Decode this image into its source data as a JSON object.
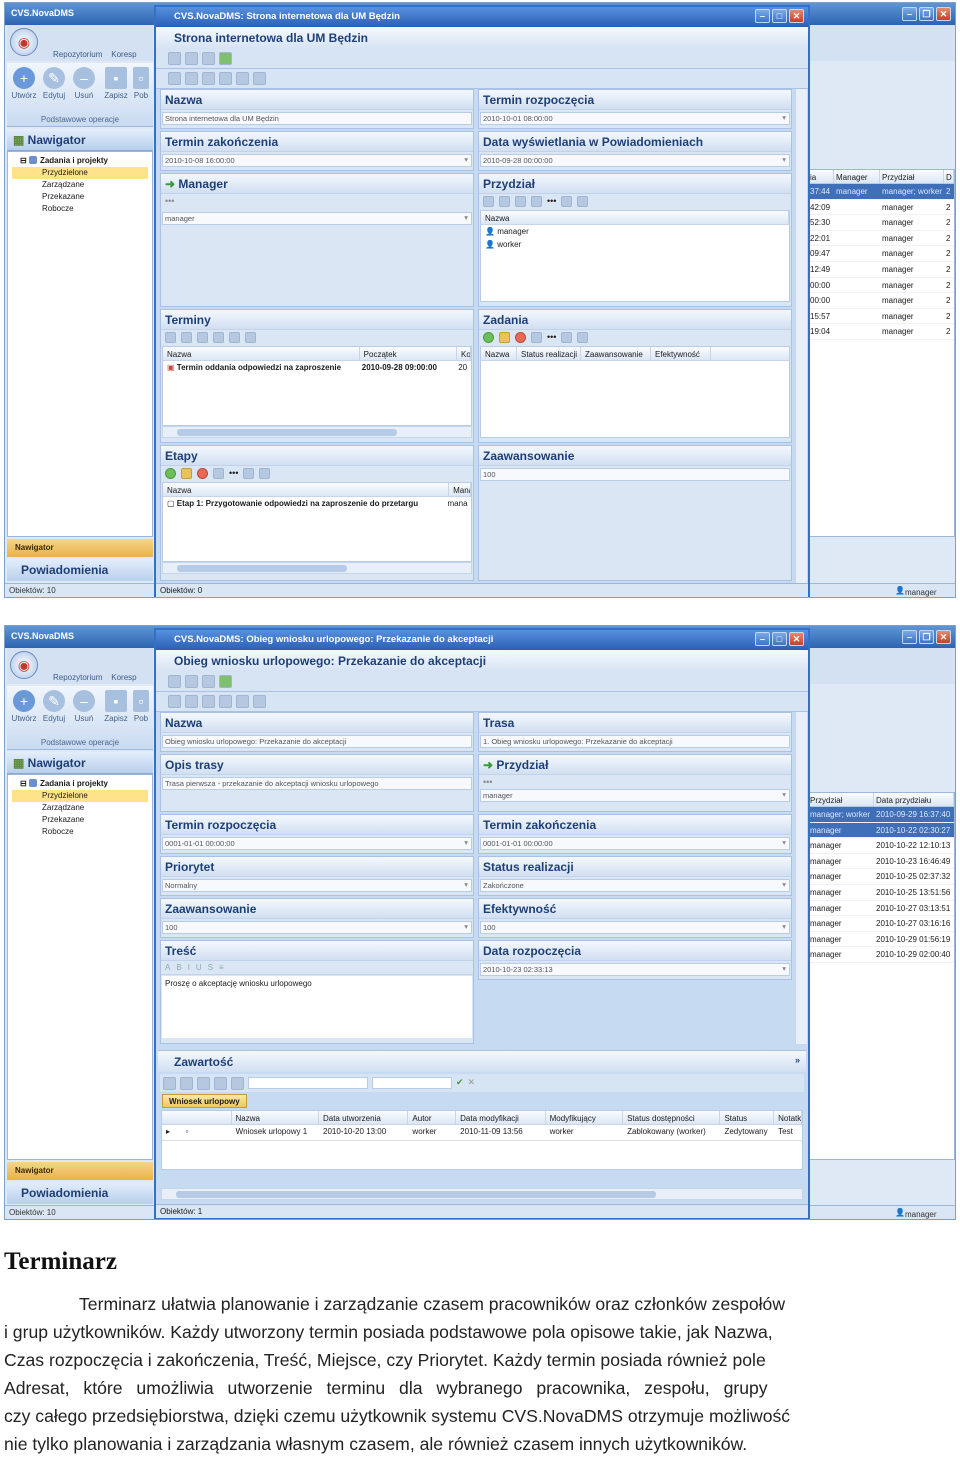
{
  "app_title": "CVS.NovaDMS",
  "qat": {
    "tab1": "Repozytorium",
    "tab2": "Koresp"
  },
  "ribbon": {
    "create": "Utwórz",
    "edit": "Edytuj",
    "delete": "Usuń",
    "save": "Zapisz",
    "pob": "Pob",
    "group": "Podstawowe operacje"
  },
  "nav": {
    "header": "Nawigator",
    "root": "Zadania i projekty",
    "items": [
      "Przydzielone",
      "Zarządzane",
      "Przekazane",
      "Robocze"
    ],
    "button": "Nawigator",
    "notifications": "Powiadomienia",
    "status": "Obiektów:  10",
    "user": "manager"
  },
  "shot1": {
    "dialog_title": "CVS.NovaDMS: Strona internetowa dla UM Będzin",
    "heading": "Strona internetowa dla UM Będzin",
    "fields": {
      "nazwa_label": "Nazwa",
      "nazwa_value": "Strona internetowa dla UM Będzin",
      "start_label": "Termin rozpoczęcia",
      "start_value": "2010-10-01 08:00:00",
      "end_label": "Termin zakończenia",
      "end_value": "2010-10-08 16:00:00",
      "display_label": "Data wyświetlania w Powiadomieniach",
      "display_value": "2010-09-28 00:00:00",
      "manager_label": "Manager",
      "manager_value": "manager",
      "assign_label": "Przydział",
      "assign_col": "Nazwa",
      "assign_rows": [
        "manager",
        "worker"
      ],
      "terms_label": "Terminy",
      "terms_cols": [
        "Nazwa",
        "Początek",
        "Ko"
      ],
      "terms_row": [
        "Termin oddania odpowiedzi na zaproszenie",
        "2010-09-28 09:00:00",
        "20"
      ],
      "tasks_label": "Zadania",
      "tasks_cols": [
        "Nazwa",
        "Status realizacji",
        "Zaawansowanie",
        "Efektywność"
      ],
      "stages_label": "Etapy",
      "stages_cols": [
        "Nazwa",
        "Mana"
      ],
      "stages_row": [
        "Etap 1: Przygotowanie odpowiedzi na zaproszenie do przetargu",
        "mana"
      ],
      "advance_label": "Zaawansowanie",
      "advance_value": "100"
    },
    "status": "Obiektów:  0",
    "grid_cols": [
      "ia",
      "Manager",
      "Przydział",
      "D"
    ],
    "grid_rows": [
      [
        "37:44",
        "manager",
        "manager; worker",
        "2"
      ],
      [
        "42:09",
        "",
        "manager",
        "2"
      ],
      [
        "52:30",
        "",
        "manager",
        "2"
      ],
      [
        "22:01",
        "",
        "manager",
        "2"
      ],
      [
        "09:47",
        "",
        "manager",
        "2"
      ],
      [
        "12:49",
        "",
        "manager",
        "2"
      ],
      [
        "00:00",
        "",
        "manager",
        "2"
      ],
      [
        "00:00",
        "",
        "manager",
        "2"
      ],
      [
        "15:57",
        "",
        "manager",
        "2"
      ],
      [
        "19:04",
        "",
        "manager",
        "2"
      ]
    ]
  },
  "shot2": {
    "dialog_title": "CVS.NovaDMS: Obieg wniosku urlopowego: Przekazanie do akceptacji",
    "heading": "Obieg wniosku urlopowego: Przekazanie do akceptacji",
    "fields": {
      "nazwa_label": "Nazwa",
      "nazwa_value": "Obieg wniosku urlopowego: Przekazanie do akceptacji",
      "trasa_label": "Trasa",
      "trasa_value": "1. Obieg wniosku urlopowego: Przekazanie do akceptacji",
      "opis_label": "Opis trasy",
      "opis_value": "Trasa pierwsza - przekazanie do akceptacji wniosku urlopowego",
      "assign_label": "Przydział",
      "assign_value": "manager",
      "start_label": "Termin rozpoczęcia",
      "start_value": "0001-01-01 00:00:00",
      "end_label": "Termin zakończenia",
      "end_value": "0001-01-01 00:00:00",
      "prio_label": "Priorytet",
      "prio_value": "Normalny",
      "status_label": "Status realizacji",
      "status_value": "Zakończone",
      "adv_label": "Zaawansowanie",
      "adv_value": "100",
      "eff_label": "Efektywność",
      "eff_value": "100",
      "body_label": "Treść",
      "body_value": "Proszę o akceptację wniosku urlopowego",
      "date_label": "Data rozpoczęcia",
      "date_value": "2010-10-23 02:33:13"
    },
    "content_label": "Zawartość",
    "content_tab": "Wniosek urlopowy",
    "content_cols": [
      "Nazwa",
      "Data utworzenia",
      "Autor",
      "Data modyfikacji",
      "Modyfikujący",
      "Status dostępności",
      "Status",
      "Notatki"
    ],
    "content_row": [
      "Wniosek urlopowy 1",
      "2010-10-20 13:00",
      "worker",
      "2010-11-09 13:56",
      "worker",
      "Zablokowany (worker)",
      "Zedytowany",
      "Test"
    ],
    "status": "Obiektów:  1",
    "grid_cols": [
      "Przydział",
      "Data przydziału"
    ],
    "grid_rows": [
      [
        "manager; worker",
        "2010-09-29 16:37:40"
      ],
      [
        "manager",
        "2010-10-22 02:30:27"
      ],
      [
        "manager",
        "2010-10-22 12:10:13"
      ],
      [
        "manager",
        "2010-10-23 16:46:49"
      ],
      [
        "manager",
        "2010-10-25 02:37:32"
      ],
      [
        "manager",
        "2010-10-25 13:51:56"
      ],
      [
        "manager",
        "2010-10-27 03:13:51"
      ],
      [
        "manager",
        "2010-10-27 03:16:16"
      ],
      [
        "manager",
        "2010-10-29 01:56:19"
      ],
      [
        "manager",
        "2010-10-29 02:00:40"
      ]
    ]
  },
  "article": {
    "heading": "Terminarz",
    "lines": [
      "Terminarz ułatwia planowanie i zarządzanie czasem pracowników oraz członków zespołów",
      "i grup użytkowników. Każdy utworzony termin posiada podstawowe pola opisowe takie, jak Nazwa,",
      "Czas rozpoczęcia i zakończenia, Treść, Miejsce, czy Priorytet. Każdy termin posiada również pole",
      "Adresat, które umożliwia utworzenie terminu dla wybranego pracownika, zespołu, grupy",
      "czy całego przedsiębiorstwa, dzięki czemu użytkownik systemu CVS.NovaDMS otrzymuje możliwość",
      "nie tylko planowania i zarządzania własnym czasem, ale również czasem innych użytkowników."
    ]
  }
}
